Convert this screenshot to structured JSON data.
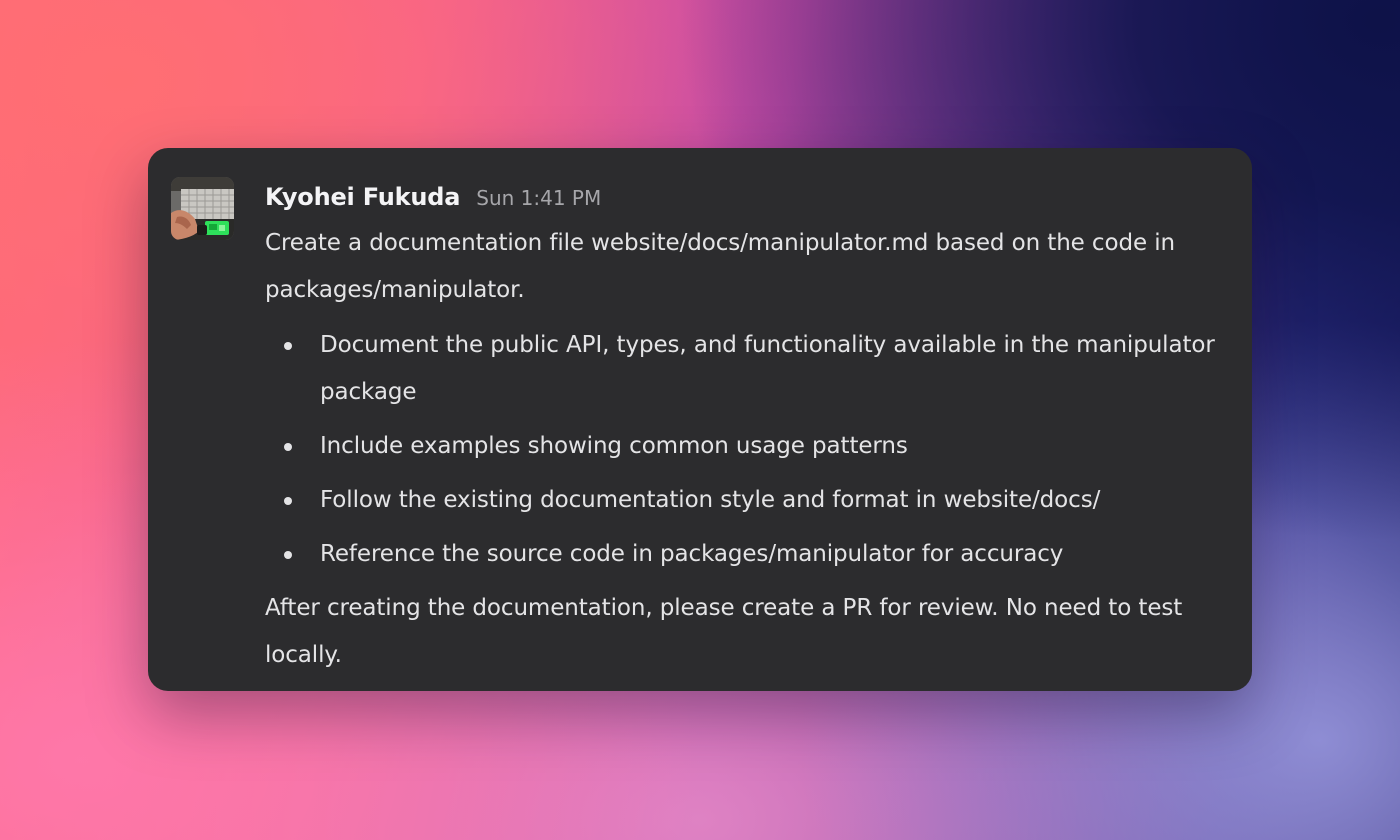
{
  "message": {
    "author": "Kyohei Fukuda",
    "timestamp": "Sun 1:41 PM",
    "avatar_icon": "user-photo-avatar",
    "intro": "Create a documentation file website/docs/manipulator.md based on the code in packages/manipulator.",
    "bullets": [
      "Document the public API, types, and functionality available in the manipulator package",
      "Include examples showing common usage patterns",
      "Follow the existing documentation style and format in website/docs/",
      "Reference the source code in packages/manipulator for accuracy"
    ],
    "outro": "After creating the documentation, please create a PR for review. No need to test locally."
  },
  "colors": {
    "card_background": "#2c2c2e",
    "text": "#e4e4e6",
    "author_text": "#f4f4f6",
    "timestamp_text": "#a6a6aa"
  }
}
